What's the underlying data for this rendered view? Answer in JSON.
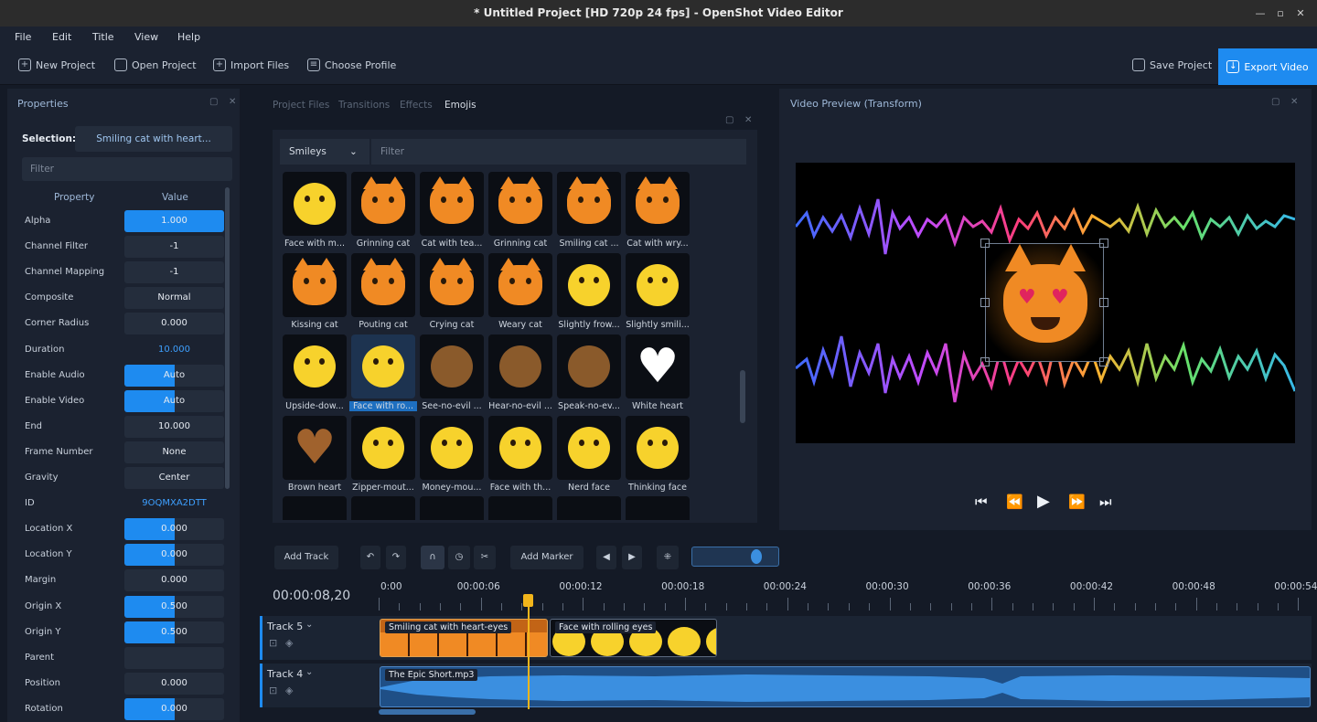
{
  "window": {
    "title": "* Untitled Project [HD 720p 24 fps] - OpenShot Video Editor"
  },
  "menu": [
    "File",
    "Edit",
    "Title",
    "View",
    "Help"
  ],
  "toolbar": {
    "new_project": "New Project",
    "open_project": "Open Project",
    "import_files": "Import Files",
    "choose_profile": "Choose Profile",
    "save_project": "Save Project",
    "export_video": "Export Video"
  },
  "properties": {
    "title": "Properties",
    "selection_label": "Selection:",
    "selection_value": "Smiling cat with heart...",
    "filter_placeholder": "Filter",
    "col_property": "Property",
    "col_value": "Value",
    "rows": [
      {
        "name": "Alpha",
        "value": "1.000",
        "fill": 1.0
      },
      {
        "name": "Channel Filter",
        "value": "-1",
        "fill": 0
      },
      {
        "name": "Channel Mapping",
        "value": "-1",
        "fill": 0
      },
      {
        "name": "Composite",
        "value": "Normal",
        "fill": 0
      },
      {
        "name": "Corner Radius",
        "value": "0.000",
        "fill": 0
      },
      {
        "name": "Duration",
        "value": "10.000",
        "fill": -1
      },
      {
        "name": "Enable Audio",
        "value": "Auto",
        "fill": 0.5
      },
      {
        "name": "Enable Video",
        "value": "Auto",
        "fill": 0.5
      },
      {
        "name": "End",
        "value": "10.000",
        "fill": 0
      },
      {
        "name": "Frame Number",
        "value": "None",
        "fill": 0
      },
      {
        "name": "Gravity",
        "value": "Center",
        "fill": 0
      },
      {
        "name": "ID",
        "value": "9OQMXA2DTT",
        "fill": -1
      },
      {
        "name": "Location X",
        "value": "0.000",
        "fill": 0.5
      },
      {
        "name": "Location Y",
        "value": "0.000",
        "fill": 0.5
      },
      {
        "name": "Margin",
        "value": "0.000",
        "fill": 0
      },
      {
        "name": "Origin X",
        "value": "0.500",
        "fill": 0.5
      },
      {
        "name": "Origin Y",
        "value": "0.500",
        "fill": 0.5
      },
      {
        "name": "Parent",
        "value": "",
        "fill": 0
      },
      {
        "name": "Position",
        "value": "0.000",
        "fill": 0
      },
      {
        "name": "Rotation",
        "value": "0.000",
        "fill": 0.5
      }
    ]
  },
  "emoji_panel": {
    "tabs": [
      "Project Files",
      "Transitions",
      "Effects",
      "Emojis"
    ],
    "active_tab": "Emojis",
    "category": "Smileys",
    "filter_placeholder": "Filter",
    "items": [
      "Face with m...",
      "Grinning cat",
      "Cat with tea...",
      "Grinning cat",
      "Smiling cat ...",
      "Cat with wry...",
      "Kissing cat",
      "Pouting cat",
      "Crying cat",
      "Weary cat",
      "Slightly frow...",
      "Slightly smili...",
      "Upside-dow...",
      "Face with ro...",
      "See-no-evil ...",
      "Hear-no-evil ...",
      "Speak-no-ev...",
      "White heart",
      "Brown heart",
      "Zipper-mout...",
      "Money-mou...",
      "Face with th...",
      "Nerd face",
      "Thinking face"
    ]
  },
  "preview": {
    "title": "Video Preview (Transform)"
  },
  "timeline": {
    "add_track": "Add Track",
    "add_marker": "Add Marker",
    "current_time": "00:00:08,20",
    "ticks": [
      "0:00",
      "00:00:06",
      "00:00:12",
      "00:00:18",
      "00:00:24",
      "00:00:30",
      "00:00:36",
      "00:00:42",
      "00:00:48",
      "00:00:54"
    ],
    "tracks": [
      {
        "name": "Track 5",
        "clips": [
          "Smiling cat with heart-eyes",
          "Face with rolling eyes"
        ]
      },
      {
        "name": "Track 4",
        "clips": [
          "The Epic Short.mp3"
        ]
      }
    ]
  },
  "colors": {
    "accent": "#1e8bf0",
    "panel": "#1b2230",
    "bg": "#141a26",
    "playhead": "#f2b51b"
  }
}
